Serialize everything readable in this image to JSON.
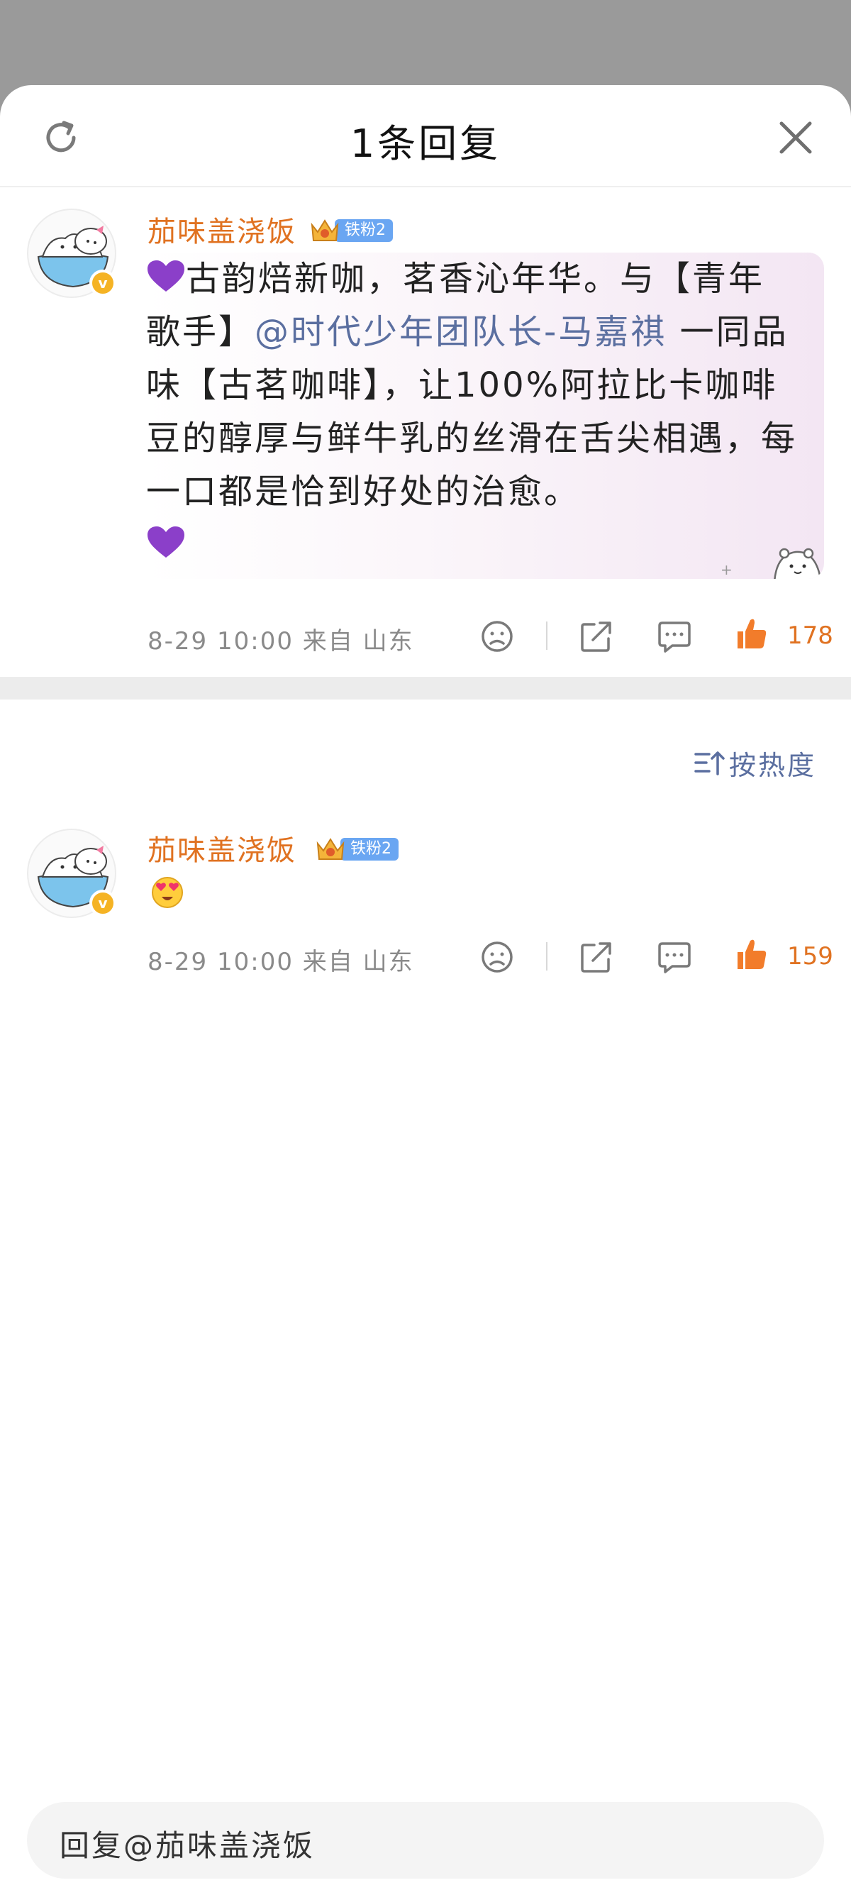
{
  "header": {
    "title": "1条回复"
  },
  "main_comment": {
    "user": "茄味盖浇饭",
    "fan_badge": "铁粉2",
    "text_before": "古韵焙新咖，茗香沁年华。与【青年歌手】",
    "mention": "@时代少年团队长-马嘉祺",
    "text_after": " 一同品味【古茗咖啡】，让100%阿拉比卡咖啡豆的醇厚与鲜牛乳的丝滑在舌尖相遇，每一口都是恰到好处的治愈。",
    "meta": "8-29 10:00 来自 山东",
    "likes": "178"
  },
  "sort": {
    "label": "按热度"
  },
  "reply_comment": {
    "user": "茄味盖浇饭",
    "fan_badge": "铁粉2",
    "meta": "8-29 10:00 来自 山东",
    "likes": "159"
  },
  "reply_input": {
    "placeholder": "回复@茄味盖浇饭"
  },
  "colors": {
    "username": "#e07221",
    "mention": "#5b6fa0",
    "badge": "#6aa6f2",
    "heart": "#8b3fc9"
  }
}
